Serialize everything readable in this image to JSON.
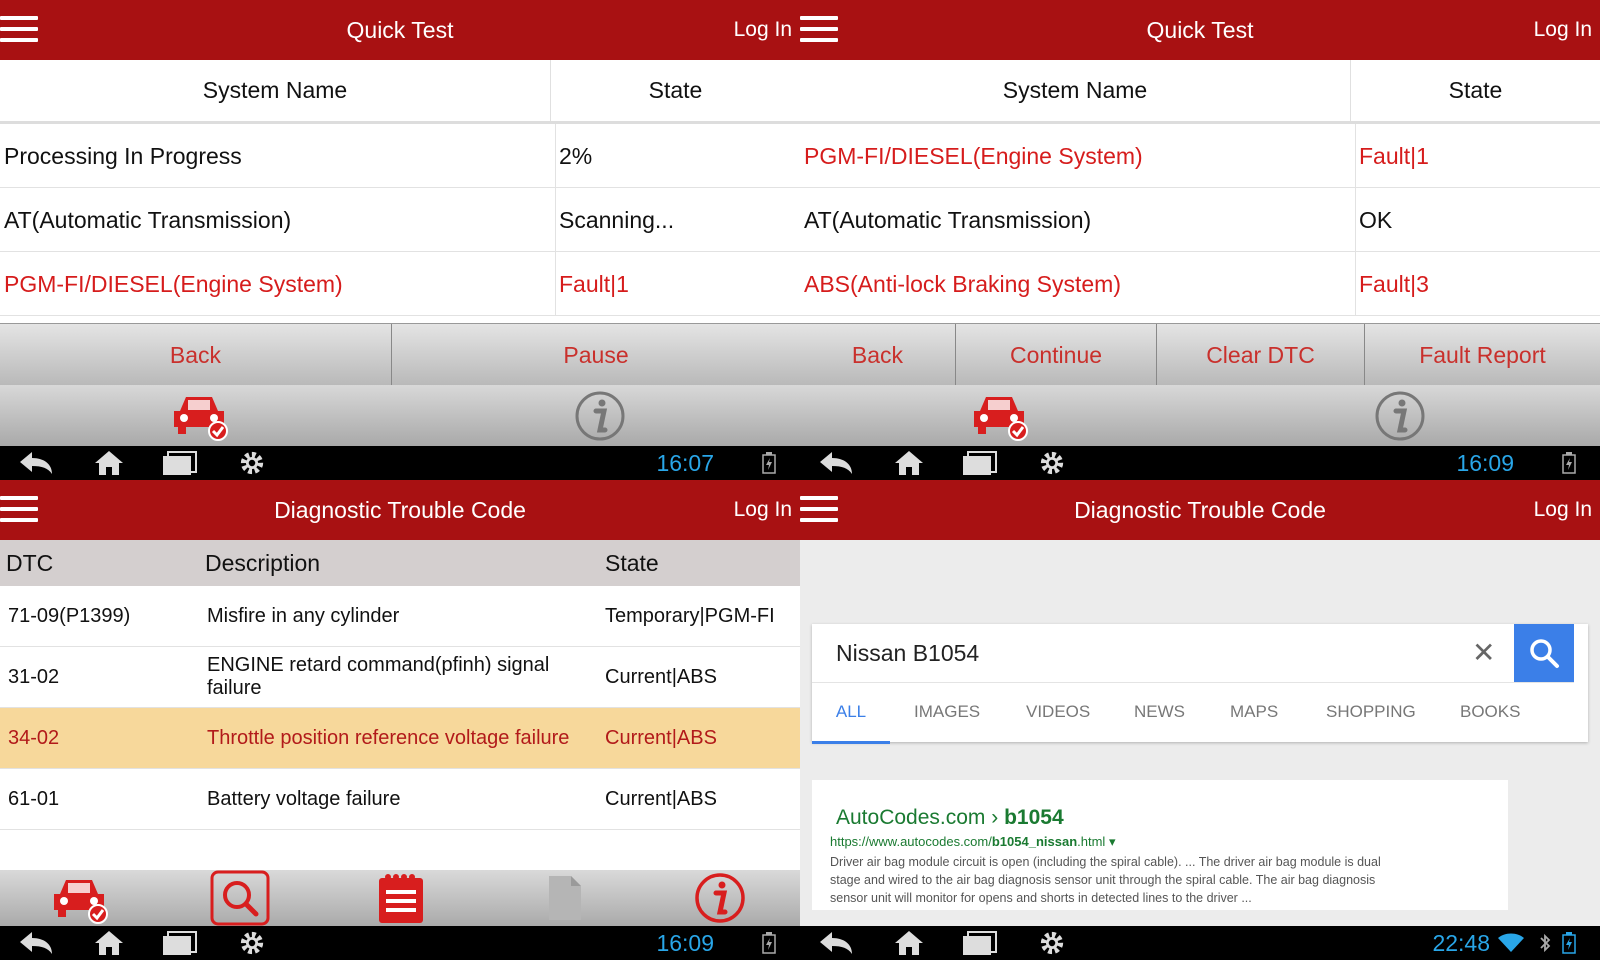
{
  "quick_test_1": {
    "title": "Quick Test",
    "login": "Log In",
    "columns": [
      "System Name",
      "State"
    ],
    "rows": [
      {
        "system": "Processing In Progress",
        "state": "2%"
      },
      {
        "system": "AT(Automatic Transmission)",
        "state": "Scanning..."
      },
      {
        "system": "PGM-FI/DIESEL(Engine System)",
        "state": "Fault|1",
        "fault": true
      }
    ],
    "buttons": [
      "Back",
      "Pause"
    ],
    "time": "16:07"
  },
  "quick_test_2": {
    "title": "Quick Test",
    "login": "Log In",
    "columns": [
      "System Name",
      "State"
    ],
    "rows": [
      {
        "system": "PGM-FI/DIESEL(Engine System)",
        "state": "Fault|1",
        "fault": true
      },
      {
        "system": "AT(Automatic Transmission)",
        "state": "OK"
      },
      {
        "system": "ABS(Anti-lock Braking System)",
        "state": "Fault|3",
        "fault": true
      }
    ],
    "buttons": [
      "Back",
      "Continue",
      "Clear DTC",
      "Fault Report"
    ],
    "time": "16:09"
  },
  "dtc": {
    "title": "Diagnostic Trouble Code",
    "login": "Log In",
    "columns": [
      "DTC",
      "Description",
      "State"
    ],
    "rows": [
      {
        "code": "71-09(P1399)",
        "description": "Misfire in any cylinder",
        "state": "Temporary|PGM-FI"
      },
      {
        "code": "31-02",
        "description": "ENGINE retard command(pfinh) signal failure",
        "state": "Current|ABS"
      },
      {
        "code": "34-02",
        "description": "Throttle position reference voltage failure",
        "state": "Current|ABS",
        "selected": true
      },
      {
        "code": "61-01",
        "description": "Battery voltage failure",
        "state": "Current|ABS"
      }
    ],
    "time": "16:09"
  },
  "search": {
    "title": "Diagnostic Trouble Code",
    "login": "Log In",
    "query": "Nissan B1054",
    "tabs": [
      "ALL",
      "IMAGES",
      "VIDEOS",
      "NEWS",
      "MAPS",
      "SHOPPING",
      "BOOKS"
    ],
    "active_tab": "ALL",
    "result": {
      "title_prefix": "AutoCodes.com › ",
      "title_term": "b1054",
      "url_prefix": "https://www.autocodes.com/",
      "url_term": "b1054_nissan",
      "url_suffix": ".html",
      "snippet": "Driver air bag module circuit is open (including the spiral cable). ... The driver air bag module is dual stage and wired to the air bag diagnosis sensor unit through the spiral cable. The air bag diagnosis sensor unit will monitor for opens and shorts in detected lines to the driver ..."
    },
    "time": "22:48"
  },
  "colors": {
    "header": "#a81112",
    "fault_text": "#d61c1c",
    "button_text": "#c9302c",
    "clock": "#29a6e8",
    "search_accent": "#3b7fe8",
    "result_link": "#1a7a31",
    "selected_row": "#f7d89b"
  },
  "icons": [
    "menu-icon",
    "car-check-icon",
    "info-icon",
    "back-icon",
    "home-icon",
    "recents-icon",
    "settings-icon",
    "battery-icon",
    "search-icon",
    "notepad-icon",
    "document-icon",
    "close-icon",
    "wifi-icon",
    "bluetooth-icon"
  ]
}
